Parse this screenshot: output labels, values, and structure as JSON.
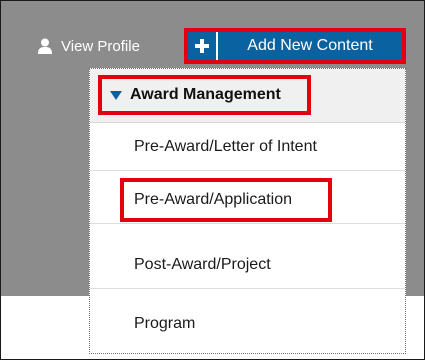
{
  "header": {
    "view_profile_label": "View Profile",
    "add_new_content_label": "Add New Content"
  },
  "menu": {
    "section_title": "Award Management",
    "items": [
      "Pre-Award/Letter of Intent",
      "Pre-Award/Application",
      "Post-Award/Project",
      "Program"
    ]
  },
  "colors": {
    "header_bg": "#8c8c8c",
    "button_bg": "#0a62a0",
    "highlight": "#e3000f"
  },
  "icons": [
    "user-icon",
    "plus-icon",
    "triangle-down-icon"
  ]
}
